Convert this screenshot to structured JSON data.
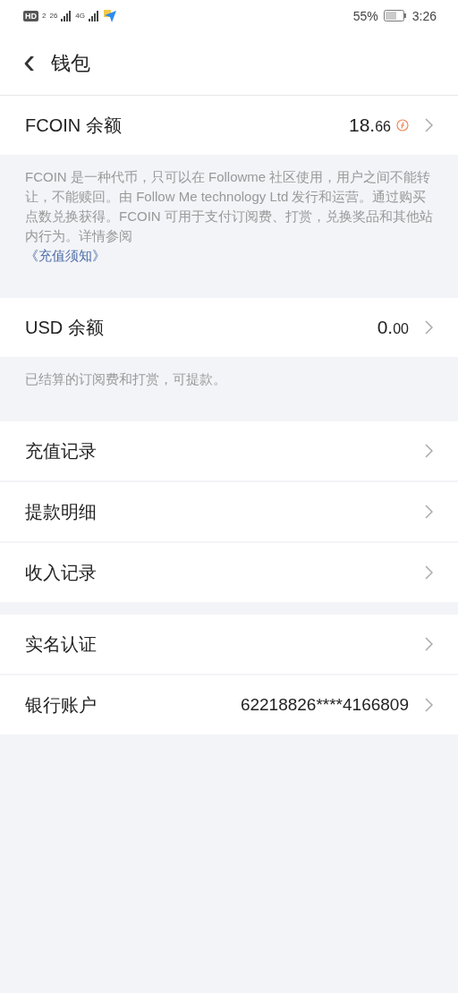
{
  "status_bar": {
    "indicators": [
      "HD",
      "2",
      "26",
      "4G"
    ],
    "battery": "55%",
    "time": "3:26"
  },
  "header": {
    "back": "‹",
    "title": "钱包"
  },
  "sections": [
    {
      "rows": [
        {
          "kind": "balance",
          "label": "FCOIN 余额",
          "integer": "18.",
          "decimal": "66",
          "coin": true
        }
      ],
      "note": {
        "text": "FCOIN 是一种代币，只可以在 Followme 社区使用，用户之间不能转让，不能赎回。由 Follow Me technology Ltd 发行和运营。通过购买点数兑换获得。FCOIN 可用于支付订阅费、打赏，兑换奖品和其他站内行为。详情参阅",
        "link": "《充值须知》"
      }
    },
    {
      "rows": [
        {
          "kind": "balance",
          "label": "USD 余额",
          "integer": "0.",
          "decimal": "00",
          "coin": false
        }
      ],
      "note": {
        "text": "已结算的订阅费和打赏，可提款。"
      }
    },
    {
      "rows": [
        {
          "kind": "link",
          "label": "充值记录"
        },
        {
          "kind": "link",
          "label": "提款明细"
        },
        {
          "kind": "link",
          "label": "收入记录"
        }
      ]
    },
    {
      "rows": [
        {
          "kind": "link",
          "label": "实名认证"
        },
        {
          "kind": "value",
          "label": "银行账户",
          "value": "62218826****4166809"
        }
      ]
    }
  ]
}
